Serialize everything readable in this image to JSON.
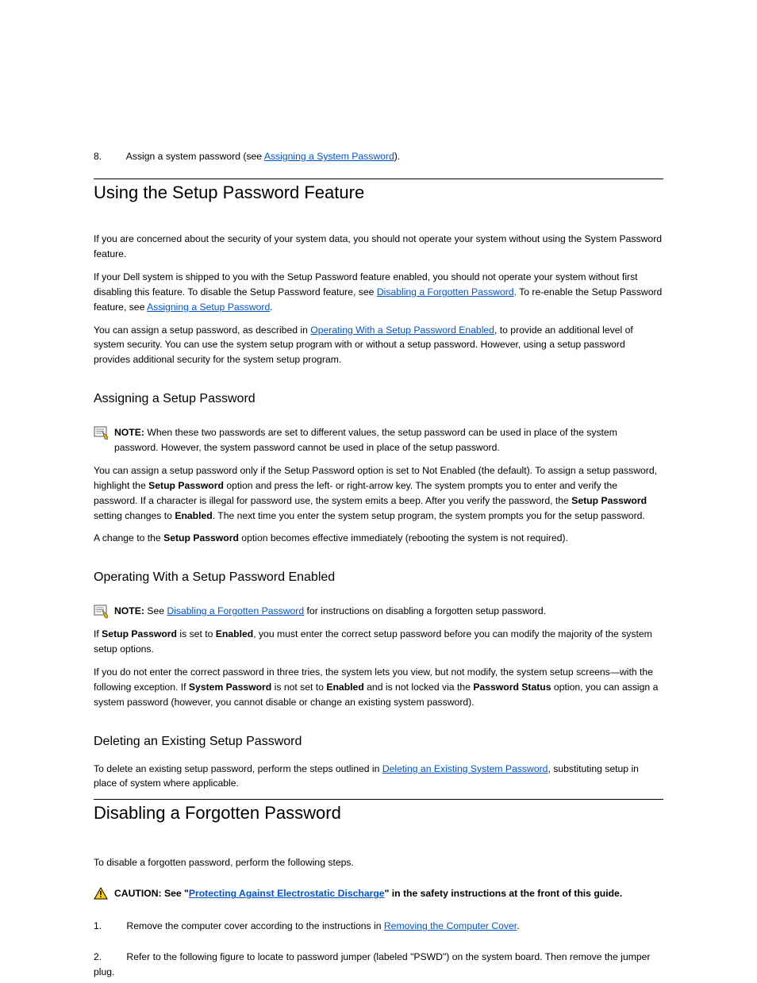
{
  "top": {
    "step8": "8.",
    "step8_text_prefix": "Assign a system password (see ",
    "step8_link": "Assigning a System Password",
    "step8_text_suffix": ")."
  },
  "hr1_heading": "Using the Setup Password Feature",
  "setup_para1": "If you are concerned about the security of your system data, you should not operate your system without using the System Password feature.",
  "setup_para2_a": "If your Dell system is shipped to you with the Setup Password feature enabled, you should not operate your system without first disabling this feature. To disable the Setup Password feature, see ",
  "setup_link_disable": "Disabling a Forgotten Password",
  "setup_para2_b": ". To re-enable the Setup Password feature, see ",
  "setup_link_assign": "Assigning a Setup Password",
  "setup_para3_a": "You can assign a setup password, as described in ",
  "setup_link_op": "Operating With a Setup Password Enabled",
  "setup_para3_b": ", to provide an additional level of system security. You can use the system setup program with or without a setup password. However, using a setup password provides additional security for the system setup program.",
  "assign_heading": "Assigning a Setup Password",
  "note1_label": "NOTE: ",
  "note1_body": "When these two passwords are set to different values, the setup password can be used in place of the system password. However, the system password cannot be used in place of the setup password.",
  "assign_p1_a": "You can assign a setup password only if the Setup Password option is set to Not Enabled (the default). To assign a setup password, highlight the ",
  "assign_p1_bold": "Setup Password",
  "assign_p1_b": " option and press the left- or right-arrow key. The system prompts you to enter and verify the password. If a character is illegal for password use, the system emits a beep. After you verify the password, the ",
  "assign_p1_bold2": "Setup Password",
  "assign_p1_c": " setting changes to ",
  "assign_p1_bold3": "Enabled",
  "assign_p1_d": ". The next time you enter the system setup program, the system prompts you for the setup password.",
  "assign_p2_a": "A change to the ",
  "assign_p2_bold": "Setup Password",
  "assign_p2_b": " option becomes effective immediately (rebooting the system is not required).",
  "op_heading": "Operating With a Setup Password Enabled",
  "note2_label": "NOTE: ",
  "note2_body_a": "See ",
  "note2_link": "Disabling a Forgotten Password",
  "note2_body_b": " for instructions on disabling a forgotten setup password.",
  "op_p1_a": "If ",
  "op_p1_bold": "Setup Password",
  "op_p1_b": " is set to ",
  "op_p1_bold2": "Enabled",
  "op_p1_c": ", you must enter the correct setup password before you can modify the majority of the system setup options.",
  "op_p2": "If you do not enter the correct password in three tries, the system lets you view, but not modify, the system setup screens—with the following exception. If ",
  "op_p2_bold": "System Password",
  "op_p2_b": " is not set to ",
  "op_p2_bold2": "Enabled",
  "op_p2_c": " and is not locked via the ",
  "op_p2_bold3": "Password Status",
  "op_p2_d": " option, you can assign a system password (however, you cannot disable or change an existing system password).",
  "del_heading": "Deleting an Existing Setup Password",
  "del_p_a": "To delete an existing setup password, perform the steps outlined in ",
  "del_link": "Deleting an Existing System Password",
  "del_p_b": ", substituting setup in place of system where applicable.",
  "hr2_heading": "Disabling a Forgotten Password",
  "dis_p1": "To disable a forgotten password, perform the following steps.",
  "caution_label": "CAUTION: ",
  "caution_a": "See \"",
  "caution_link1": "Protecting Against Electrostatic Discharge",
  "caution_b": "\" in the safety instructions at the front of this guide.",
  "dis_step1": "1.",
  "dis_step1_text_a": "Remove the computer cover according to the instructions in ",
  "dis_step1_link": "Removing the Computer Cover",
  "dis_step1_text_b": ".",
  "dis_step2": "2.",
  "dis_step2_text": "Refer to the following figure to locate to password jumper (labeled \"PSWD\") on the system board. Then remove the jumper plug."
}
